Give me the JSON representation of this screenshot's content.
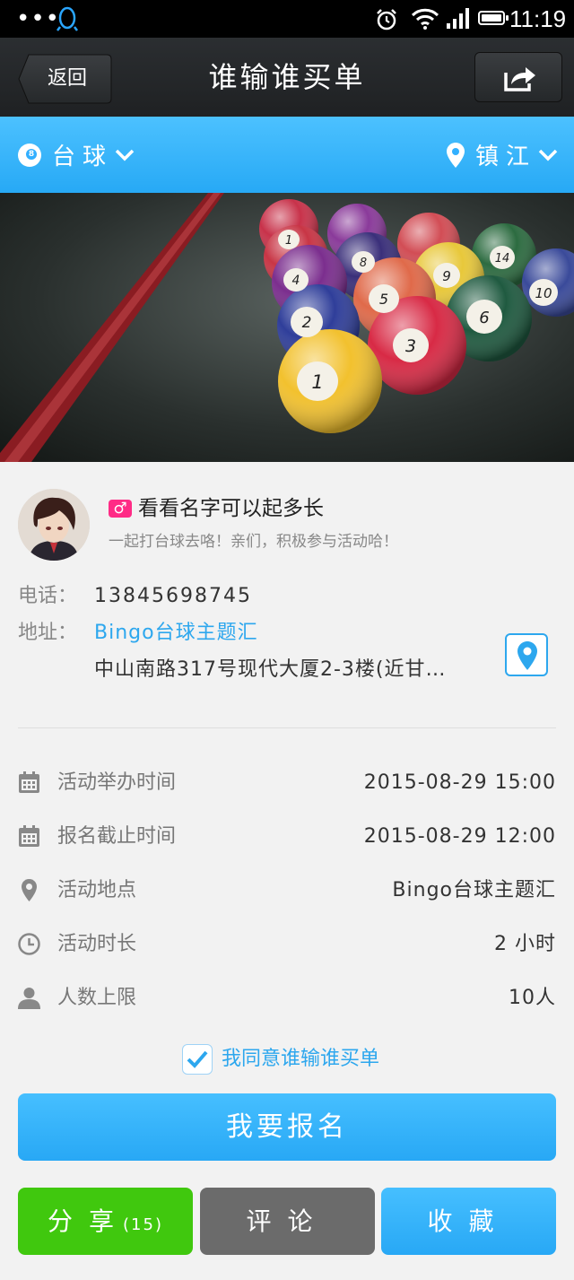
{
  "status_bar": {
    "time": "11:19"
  },
  "nav": {
    "back_label": "返回",
    "title": "谁输谁买单"
  },
  "filter": {
    "category": "台球",
    "city": "镇江"
  },
  "host": {
    "name": "看看名字可以起多长",
    "gender_symbol": "♂",
    "description": "一起打台球去咯！亲们，积极参与活动哈！"
  },
  "contact": {
    "phone_label": "电话：",
    "phone": "13845698745",
    "address_label": "地址：",
    "venue": "Bingo台球主题汇",
    "address": "中山南路317号现代大厦2-3楼(近甘…"
  },
  "details": [
    {
      "icon": "calendar-icon",
      "label": "活动举办时间",
      "value": "2015-08-29  15:00"
    },
    {
      "icon": "calendar-icon",
      "label": "报名截止时间",
      "value": "2015-08-29  12:00"
    },
    {
      "icon": "location-pin-icon",
      "label": "活动地点",
      "value": "Bingo台球主题汇"
    },
    {
      "icon": "clock-icon",
      "label": "活动时长",
      "value": "2 小时"
    },
    {
      "icon": "person-icon",
      "label": "人数上限",
      "value": "10人"
    }
  ],
  "agree": {
    "checked": true,
    "text": "我同意谁输谁买单"
  },
  "signup_label": "我要报名",
  "buttons": {
    "share": "分享",
    "share_count": "(15)",
    "comment": "评论",
    "favorite": "收藏"
  },
  "colors": {
    "accent_blue": "#2da7ee",
    "share_green": "#40c80e",
    "comment_gray": "#6b6b6b",
    "gender_pink": "#ff2b86"
  }
}
